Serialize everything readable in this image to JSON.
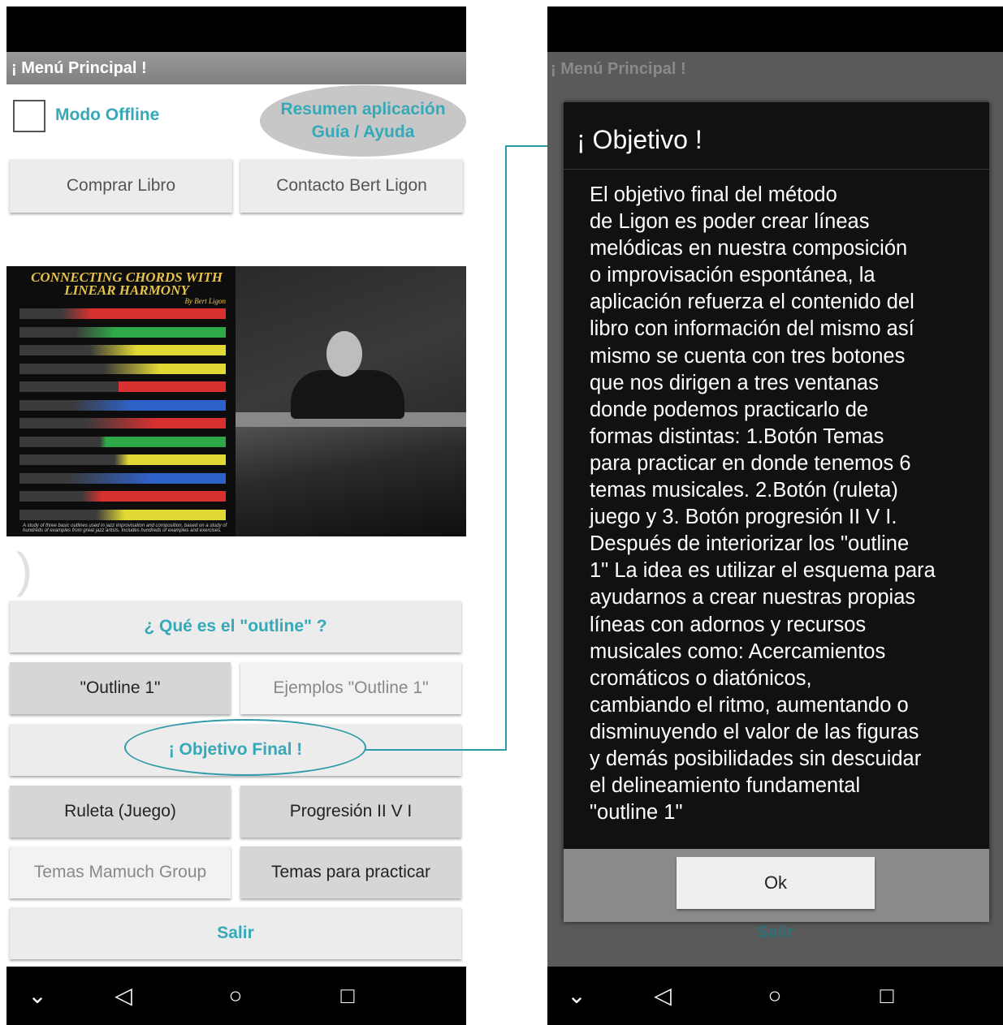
{
  "app": {
    "title": "¡ Menú Principal !",
    "offline_label": "Modo Offline",
    "help_line1": "Resumen aplicación",
    "help_line2": "Guía / Ayuda"
  },
  "buttons": {
    "comprar": "Comprar Libro",
    "contacto": "Contacto Bert Ligon",
    "outline_question": "¿ Qué es el \"outline\" ?",
    "outline1": "\"Outline 1\"",
    "ejemplos": "Ejemplos \"Outline 1\"",
    "objetivo": "¡ Objetivo Final !",
    "ruleta": "Ruleta (Juego)",
    "progresion": "Progresión II V I",
    "mamuch": "Temas Mamuch Group",
    "practicar": "Temas para practicar",
    "salir": "Salir"
  },
  "cover": {
    "title_line1": "CONNECTING CHORDS WITH",
    "title_line2": "LINEAR HARMONY",
    "author": "By Bert Ligon",
    "tagline": "A study of three basic outlines used in jazz improvisation and composition, based on a study of hundreds of examples from great jazz artists. Includes hundreds of examples and exercises.",
    "stripe_colors": [
      "#d93030",
      "#2fa84a",
      "#e3d935",
      "#e3d935",
      "#d93030",
      "#2f62c8",
      "#d93030",
      "#2fa84a",
      "#e3d935",
      "#2f62c8",
      "#d93030",
      "#e3d935"
    ]
  },
  "nav": {
    "back_icon": "◁",
    "home_icon": "○",
    "recents_icon": "□",
    "down_icon": "⌄"
  },
  "dialog": {
    "title": "¡ Objetivo !",
    "body": "El objetivo final del método\nde Ligon es poder crear líneas\nmelódicas en nuestra composición\no improvisación espontánea, la\naplicación refuerza el contenido del\nlibro con información del mismo así\nmismo se cuenta con tres botones\nque nos dirigen a tres ventanas\ndonde podemos practicarlo de\nformas distintas: 1.Botón Temas\npara practicar en donde tenemos 6\ntemas musicales. 2.Botón (ruleta)\njuego y 3. Botón progresión II V I.\nDespués de interiorizar los \"outline\n1\" La idea es utilizar el esquema para\nayudarnos a crear nuestras propias\nlíneas con adornos y recursos\nmusicales como: Acercamientos\ncromáticos o diatónicos,\ncambiando el ritmo, aumentando o\ndisminuyendo el valor de las figuras\ny demás posibilidades sin descuidar\nel delineamiento fundamental\n\"outline 1\"",
    "ok": "Ok"
  },
  "colors": {
    "accent": "#36a9b8",
    "annotation": "#2f9aa8"
  }
}
